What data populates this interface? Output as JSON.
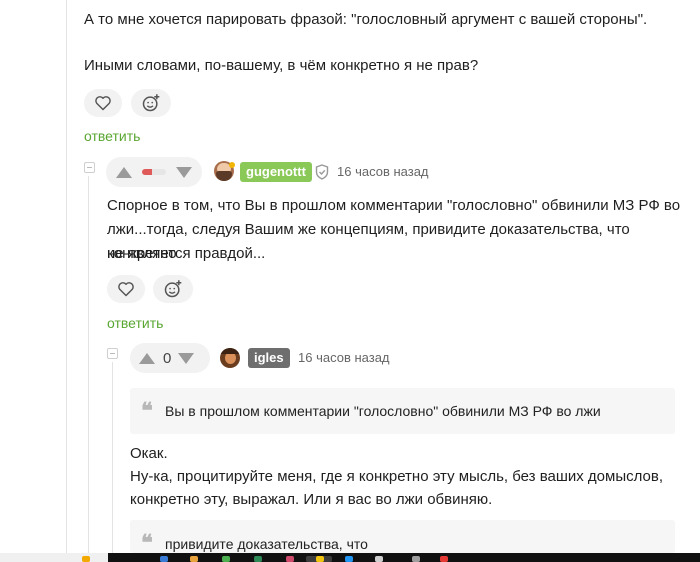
{
  "comment1": {
    "line1": "А то мне хочется парировать фразой: \"голословный аргумент с вашей стороны\".",
    "line2": "Иными словами, по-вашему, в чём конкретно я не прав?",
    "reply_label": "ответить"
  },
  "comment2": {
    "username": "gugenottt",
    "time": "16 часов назад",
    "text_lines": [
      "Спорное в том, что Вы в прошлом комментарии \"голословно\" обвинили МЗ РФ во",
      "лжи...тогда, следуя Вашим же концепциям, привидите доказательства, что конкретно",
      "не является правдой..."
    ],
    "reply_label": "ответить",
    "rating_color": "#e05a5a"
  },
  "comment3": {
    "rating": "0",
    "username": "igles",
    "time": "16 часов назад",
    "quote": "Вы в прошлом комментарии \"голословно\" обвинили МЗ РФ во лжи",
    "text_lines": [
      "Окак.",
      "Ну-ка, процитируйте меня, где я конкретно эту мысль, без ваших домыслов,",
      "конкретно эту, выражал. Или я вас во лжи обвиняю."
    ],
    "quote2": "привидите доказательства, что"
  },
  "colors": {
    "accent_green": "#5aa632",
    "nick_green": "#8ac858",
    "nick_gray": "#6e6e6e"
  }
}
